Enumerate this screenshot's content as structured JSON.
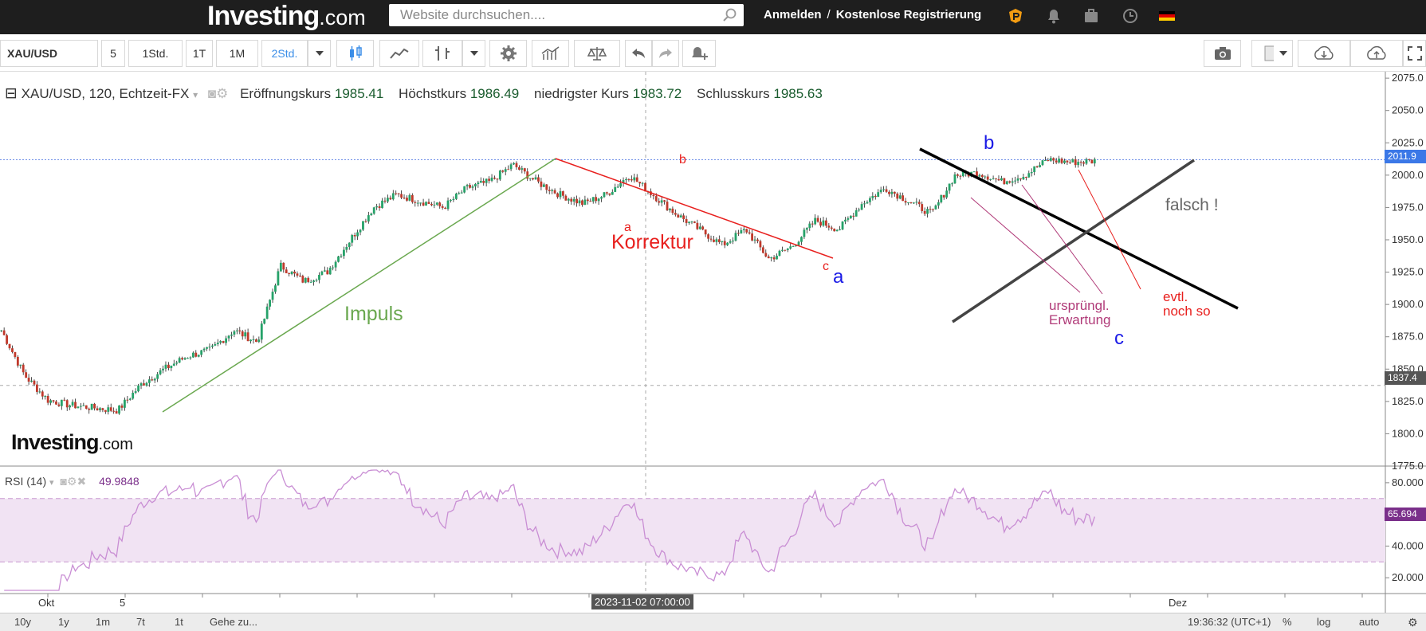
{
  "header": {
    "logo_main": "Investing",
    "logo_suffix": ".com",
    "search_placeholder": "Website durchsuchen....",
    "login": "Anmelden",
    "separator": "/",
    "register": "Kostenlose Registrierung"
  },
  "toolbar": {
    "symbol": "XAU/USD",
    "intervals": [
      "5",
      "1Std.",
      "1T",
      "1M",
      "2Std."
    ],
    "active_interval": "2Std."
  },
  "legend": {
    "symbol_title": "XAU/USD, 120, Echtzeit-FX",
    "open_label": "Eröffnungskurs",
    "open_value": "1985.41",
    "high_label": "Höchstkurs",
    "high_value": "1986.49",
    "low_label": "niedrigster Kurs",
    "low_value": "1983.72",
    "close_label": "Schlusskurs",
    "close_value": "1985.63"
  },
  "price_axis": {
    "ticks": [
      "2075.0",
      "2050.0",
      "2025.0",
      "2000.0",
      "1975.0",
      "1950.0",
      "1925.0",
      "1900.0",
      "1875.0",
      "1850.0",
      "1825.0",
      "1800.0",
      "1775.0"
    ],
    "current_price_tag": "2011.9",
    "crosshair_price_tag": "1837.4"
  },
  "rsi": {
    "label": "RSI (14)",
    "value": "49.9848",
    "ticks": [
      "80.000",
      "60.000",
      "40.000",
      "20.000"
    ],
    "current_tag": "65.694"
  },
  "time_axis": {
    "labels": [
      "Okt",
      "5",
      "Dez"
    ],
    "crosshair_time": "2023-11-02 07:00:00"
  },
  "annotations": {
    "impuls": "Impuls",
    "korrektur": "Korrektur",
    "wave_a_small": "a",
    "wave_b_small": "b",
    "wave_c_small": "c",
    "wave_a_blue": "a",
    "wave_b_blue": "b",
    "wave_c_blue": "c",
    "falsch": "falsch !",
    "urspruenglich_1": "ursprüngl.",
    "urspruenglich_2": "Erwartung",
    "evtl_1": "evtl.",
    "evtl_2": "noch so"
  },
  "watermark": {
    "main": "Investing",
    "suffix": ".com"
  },
  "bottom_bar": {
    "ranges": [
      "10y",
      "1y",
      "1m",
      "7t",
      "1t"
    ],
    "goto": "Gehe zu...",
    "time": "19:36:32 (UTC+1)",
    "percent": "%",
    "log": "log",
    "auto": "auto"
  },
  "chart_data": {
    "type": "candlestick",
    "instrument": "XAU/USD",
    "ylim": [
      1775,
      2080
    ],
    "rsi_ylim": [
      10,
      90
    ],
    "rsi_band": [
      30,
      70
    ],
    "close_path": [
      {
        "label": "Okt",
        "y": 1880
      },
      {
        "y": 1845
      },
      {
        "y": 1826
      },
      {
        "y": 1822
      },
      {
        "y": 1820
      },
      {
        "y": 1818
      },
      {
        "y": 1838
      },
      {
        "y": 1850
      },
      {
        "y": 1860
      },
      {
        "y": 1865
      },
      {
        "y": 1880
      },
      {
        "y": 1871
      },
      {
        "y": 1930
      },
      {
        "y": 1918
      },
      {
        "y": 1925
      },
      {
        "y": 1950
      },
      {
        "y": 1975
      },
      {
        "y": 1985
      },
      {
        "y": 1980
      },
      {
        "y": 1975
      },
      {
        "y": 1990
      },
      {
        "y": 1995
      },
      {
        "y": 2008
      },
      {
        "y": 1995
      },
      {
        "y": 1985
      },
      {
        "y": 1978
      },
      {
        "y": 1985
      },
      {
        "y": 2000
      },
      {
        "y": 1985
      },
      {
        "y": 1970
      },
      {
        "y": 1958
      },
      {
        "y": 1946
      },
      {
        "y": 1958
      },
      {
        "y": 1935
      },
      {
        "y": 1945
      },
      {
        "y": 1965
      },
      {
        "y": 1958
      },
      {
        "y": 1978
      },
      {
        "y": 1990
      },
      {
        "y": 1980
      },
      {
        "y": 1970
      },
      {
        "y": 2000
      },
      {
        "y": 2002
      },
      {
        "y": 1995
      },
      {
        "y": 2000
      },
      {
        "y": 2012
      },
      {
        "y": 2010
      },
      {
        "label": "Dez",
        "y": 2011
      }
    ],
    "colors": {
      "up": "#26a269",
      "down": "#c0392b",
      "rsi": "#c98ed4",
      "rsi_band": "#f1e3f3"
    }
  }
}
